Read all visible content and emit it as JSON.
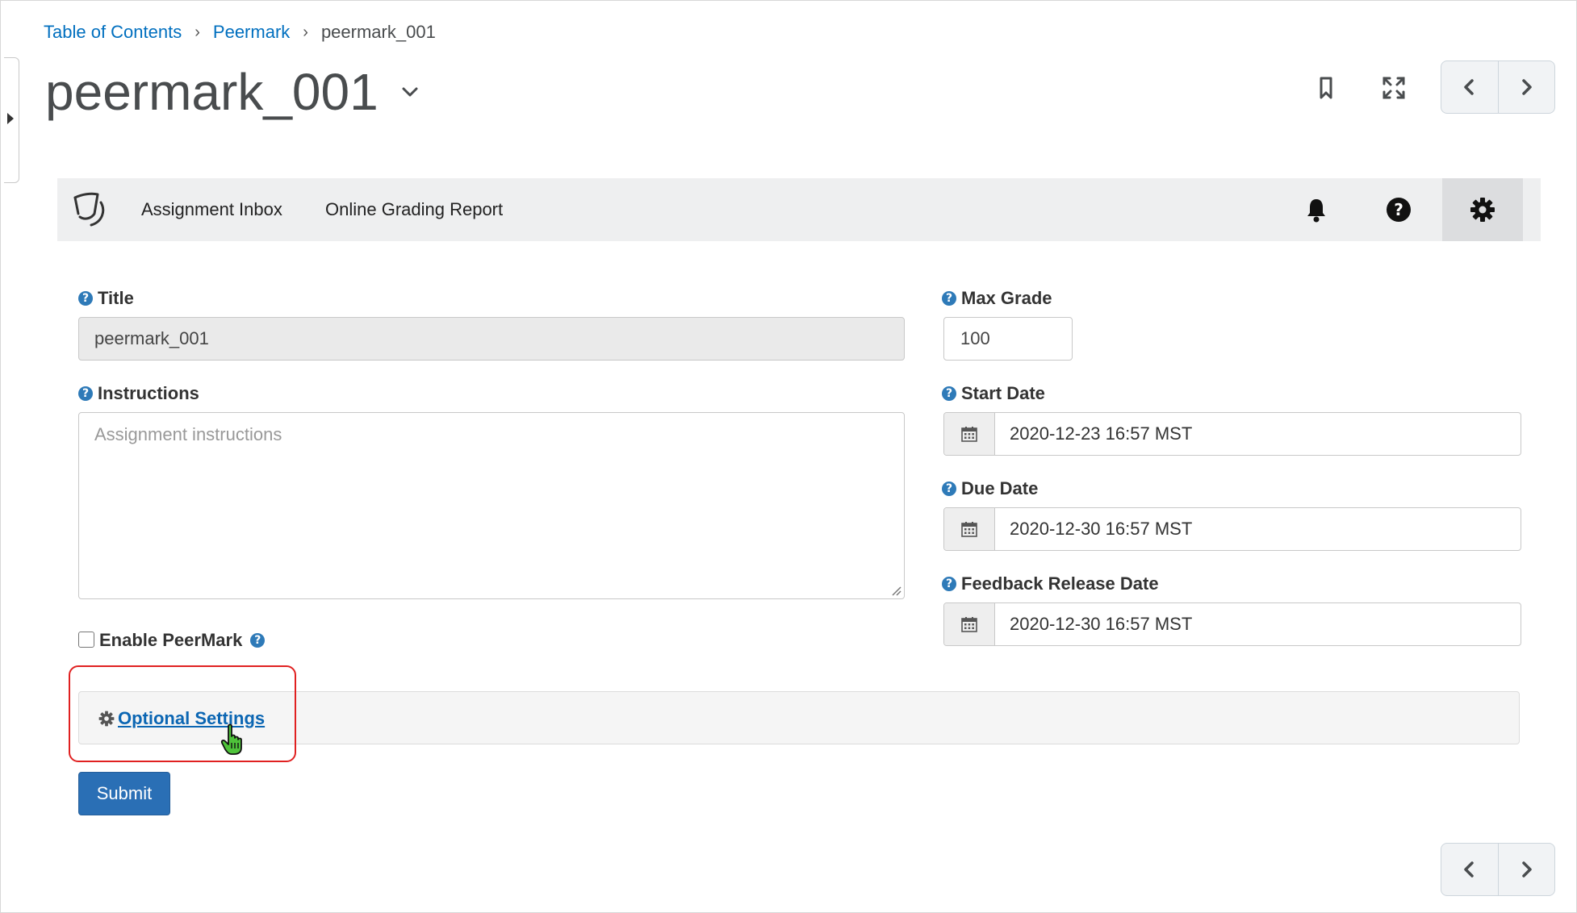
{
  "breadcrumb": {
    "items": [
      "Table of Contents",
      "Peermark"
    ],
    "separator": "›",
    "current": "peermark_001"
  },
  "page": {
    "title": "peermark_001"
  },
  "toolbar": {
    "bookmark_icon": "bookmark-icon",
    "fullscreen_icon": "fullscreen-icon",
    "prev_icon": "chevron-left-icon",
    "next_icon": "chevron-right-icon"
  },
  "turnitin_bar": {
    "logo_icon": "turnitin-logo-icon",
    "links": [
      "Assignment Inbox",
      "Online Grading Report"
    ],
    "icons": [
      "bell-icon",
      "help-icon",
      "gear-icon"
    ]
  },
  "form": {
    "title_label": "Title",
    "title_value": "peermark_001",
    "instructions_label": "Instructions",
    "instructions_placeholder": "Assignment instructions",
    "enable_peermark_label": "Enable PeerMark",
    "enable_peermark_checked": false,
    "max_grade_label": "Max Grade",
    "max_grade_value": "100",
    "start_date_label": "Start Date",
    "start_date_value": "2020-12-23 16:57 MST",
    "due_date_label": "Due Date",
    "due_date_value": "2020-12-30 16:57 MST",
    "feedback_date_label": "Feedback Release Date",
    "feedback_date_value": "2020-12-30 16:57 MST",
    "optional_settings_label": "Optional Settings",
    "submit_label": "Submit"
  },
  "colors": {
    "link": "#006fbf",
    "primary_button": "#2a6fb5",
    "highlight": "#e02020",
    "help_icon": "#2e7ab8"
  }
}
